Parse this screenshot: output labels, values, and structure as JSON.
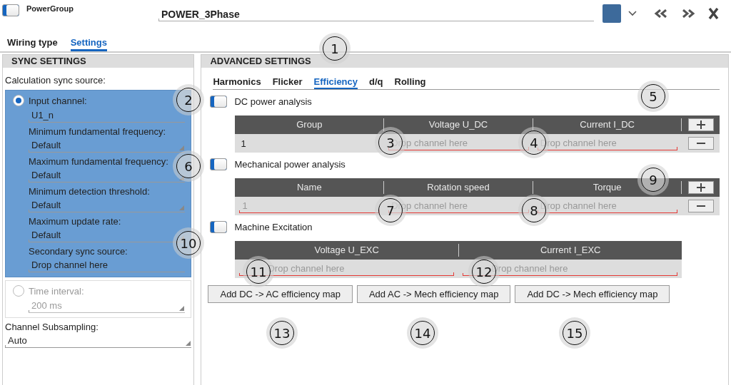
{
  "header": {
    "toggle": {
      "on": true
    },
    "group_label": "PowerGroup",
    "name": "POWER_3Phase"
  },
  "tabs": [
    {
      "label": "Wiring type",
      "selected": false
    },
    {
      "label": "Settings",
      "selected": true
    }
  ],
  "sync_settings": {
    "title": "SYNC SETTINGS",
    "source_label": "Calculation sync source:",
    "options": [
      {
        "label": "Input channel:",
        "selected": true,
        "fields": [
          {
            "value": "U1_n",
            "kind": "text"
          },
          {
            "label": "Minimum fundamental frequency:",
            "value": "Default",
            "kind": "dropdown"
          },
          {
            "label": "Maximum fundamental frequency:",
            "value": "Default",
            "kind": "dropdown"
          },
          {
            "label": "Minimum detection threshold:",
            "value": "Default",
            "kind": "dropdown"
          },
          {
            "label": "Maximum update rate:",
            "value": "Default",
            "kind": "dropdown"
          },
          {
            "label": "Secondary sync source:",
            "value": "Drop channel here",
            "kind": "text"
          }
        ]
      },
      {
        "label": "Time interval:",
        "selected": false,
        "fields": [
          {
            "value": "200 ms",
            "kind": "dropdown"
          }
        ]
      }
    ],
    "subsampling": {
      "label": "Channel Subsampling:",
      "value": "Auto"
    }
  },
  "advanced_settings": {
    "title": "ADVANCED SETTINGS",
    "tabs": [
      {
        "label": "Harmonics",
        "selected": false
      },
      {
        "label": "Flicker",
        "selected": false
      },
      {
        "label": "Efficiency",
        "selected": true
      },
      {
        "label": "d/q",
        "selected": false
      },
      {
        "label": "Rolling",
        "selected": false
      }
    ],
    "sections": [
      {
        "label": "DC power analysis",
        "on": true,
        "has_buttons": true,
        "columns": [
          "Group",
          "Voltage U_DC",
          "Current I_DC"
        ],
        "cells": [
          {
            "kind": "text",
            "value": "1"
          },
          {
            "kind": "drop",
            "placeholder": "Drop channel here"
          },
          {
            "kind": "drop",
            "placeholder": "Drop channel here"
          }
        ]
      },
      {
        "label": "Mechanical power analysis",
        "on": true,
        "has_buttons": true,
        "columns": [
          "Name",
          "Rotation speed",
          "Torque"
        ],
        "cells": [
          {
            "kind": "drop",
            "value": "1"
          },
          {
            "kind": "drop",
            "placeholder": "Drop channel here"
          },
          {
            "kind": "drop",
            "placeholder": "Drop channel here"
          }
        ]
      },
      {
        "label": "Machine Excitation",
        "on": true,
        "has_buttons": false,
        "columns": [
          "Voltage U_EXC",
          "Current I_EXC"
        ],
        "cells": [
          {
            "kind": "drop",
            "placeholder": "Drop channel here"
          },
          {
            "kind": "drop",
            "placeholder": "Drop channel here"
          }
        ]
      }
    ],
    "buttons": [
      "Add DC -> AC efficiency map",
      "Add AC -> Mech efficiency map",
      "Add DC -> Mech efficiency map"
    ]
  },
  "callouts": [
    "1",
    "2",
    "3",
    "4",
    "5",
    "6",
    "7",
    "8",
    "9",
    "10",
    "11",
    "12",
    "13",
    "14",
    "15"
  ]
}
